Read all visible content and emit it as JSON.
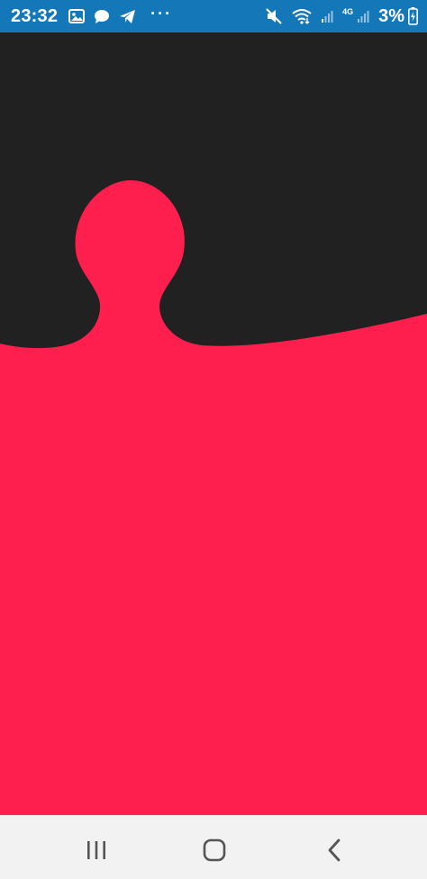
{
  "status_bar": {
    "time": "23:32",
    "battery_percent": "3%",
    "network_type": "4G",
    "overflow": "···",
    "left_icons": [
      "gallery-icon",
      "chat-bubble-icon",
      "telegram-icon"
    ],
    "right_icons": [
      "mute-icon",
      "wifi-icon",
      "signal-icon",
      "signal-icon",
      "battery-charging-icon"
    ],
    "color": "#1478b8"
  },
  "canvas": {
    "background_color": "#212121",
    "shape_color": "#fe1f4e"
  },
  "nav_bar": {
    "buttons": [
      "recents-icon",
      "home-icon",
      "back-icon"
    ],
    "color": "#f2f2f2"
  }
}
